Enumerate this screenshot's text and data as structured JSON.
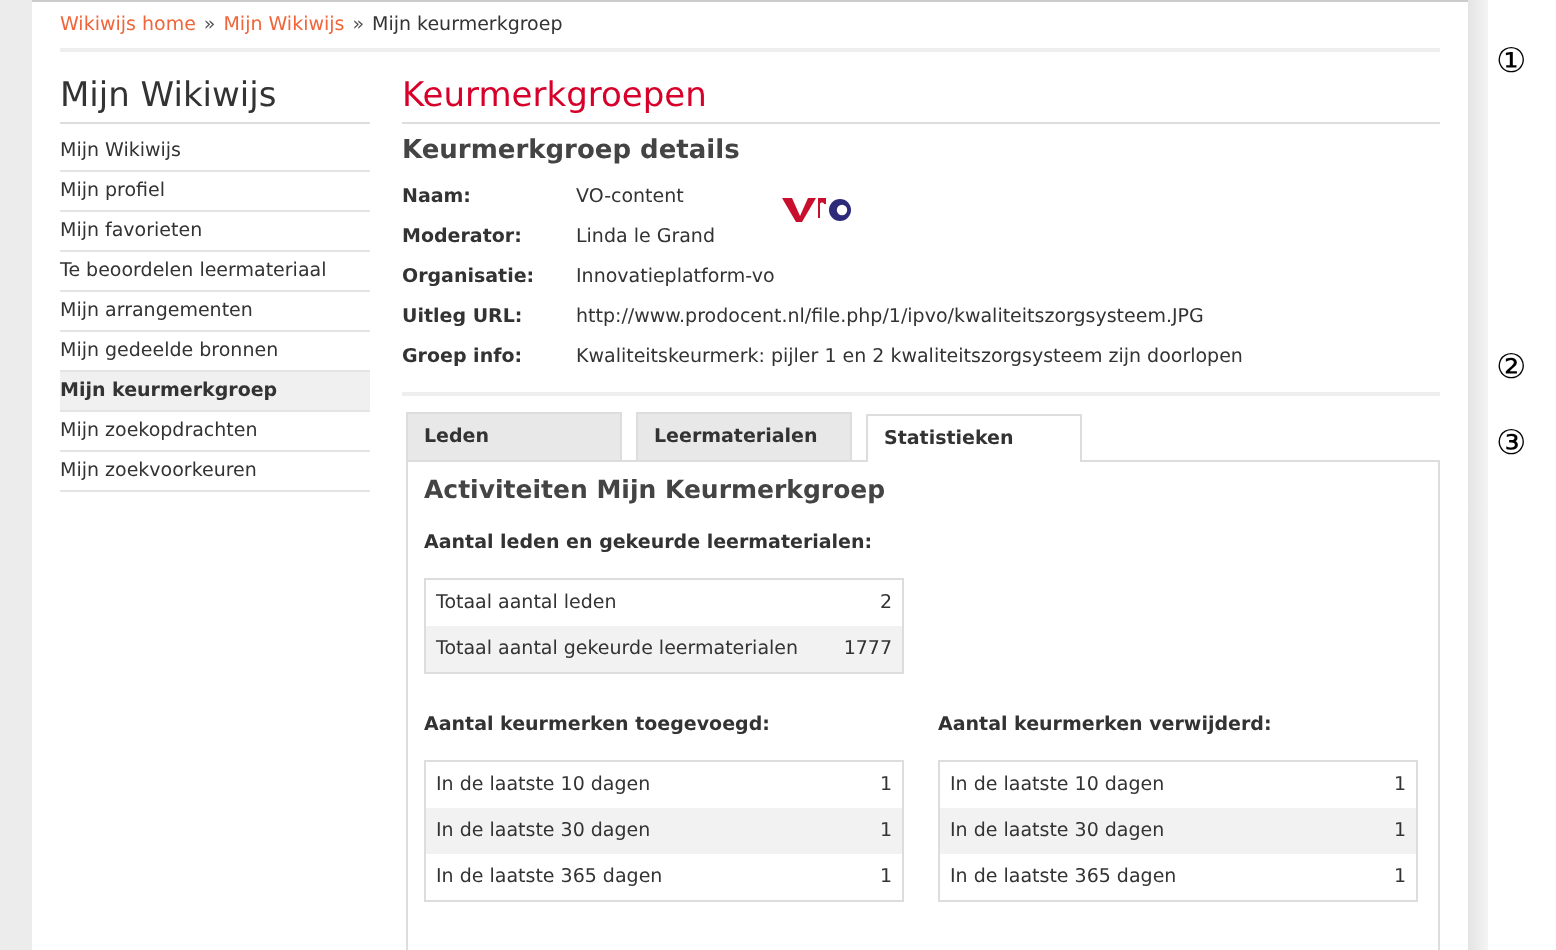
{
  "breadcrumb": {
    "separator": "»",
    "items": [
      {
        "label": "Wikiwijs home",
        "link": true
      },
      {
        "label": "Mijn Wikiwijs",
        "link": true
      },
      {
        "label": "Mijn keurmerkgroep",
        "link": false
      }
    ]
  },
  "sidebar": {
    "title": "Mijn Wikiwijs",
    "items": [
      {
        "label": "Mijn Wikiwijs",
        "selected": false
      },
      {
        "label": "Mijn profiel",
        "selected": false
      },
      {
        "label": "Mijn favorieten",
        "selected": false
      },
      {
        "label": "Te beoordelen leermateriaal",
        "selected": false
      },
      {
        "label": "Mijn arrangementen",
        "selected": false
      },
      {
        "label": "Mijn gedeelde bronnen",
        "selected": false
      },
      {
        "label": "Mijn keurmerkgroep",
        "selected": true
      },
      {
        "label": "Mijn zoekopdrachten",
        "selected": false
      },
      {
        "label": "Mijn zoekvoorkeuren",
        "selected": false
      }
    ]
  },
  "page_title": "Keurmerkgroepen",
  "details": {
    "title": "Keurmerkgroep details",
    "fields": [
      {
        "label": "Naam:",
        "value": "VO-content"
      },
      {
        "label": "Moderator:",
        "value": "Linda le Grand"
      },
      {
        "label": "Organisatie:",
        "value": "Innovatieplatform-vo"
      },
      {
        "label": "Uitleg URL:",
        "value": "http://www.prodocent.nl/file.php/1/ipvo/kwaliteitszorgsysteem.JPG"
      },
      {
        "label": "Groep info:",
        "value": "Kwaliteitskeurmerk: pijler 1 en 2 kwaliteitszorgsysteem zijn doorlopen"
      }
    ]
  },
  "tabs": [
    {
      "label": "Leden",
      "selected": false
    },
    {
      "label": "Leermaterialen",
      "selected": false
    },
    {
      "label": "Statistieken",
      "selected": true
    }
  ],
  "stats": {
    "title": "Activiteiten Mijn Keurmerkgroep",
    "totals": {
      "heading": "Aantal leden en gekeurde leermaterialen:",
      "rows": [
        {
          "label": "Totaal aantal leden",
          "value": "2"
        },
        {
          "label": "Totaal aantal gekeurde leermaterialen",
          "value": "1777"
        }
      ]
    },
    "tables": [
      {
        "heading": "Aantal keurmerken toegevoegd:",
        "rows": [
          {
            "label": "In de laatste 10 dagen",
            "value": "1"
          },
          {
            "label": "In de laatste 30 dagen",
            "value": "1"
          },
          {
            "label": "In de laatste 365 dagen",
            "value": "1"
          }
        ]
      },
      {
        "heading": "Aantal keurmerken verwijderd:",
        "rows": [
          {
            "label": "In de laatste 10 dagen",
            "value": "1"
          },
          {
            "label": "In de laatste 30 dagen",
            "value": "1"
          },
          {
            "label": "In de laatste 365 dagen",
            "value": "1"
          }
        ]
      }
    ]
  },
  "callouts": [
    "①",
    "②",
    "③"
  ]
}
